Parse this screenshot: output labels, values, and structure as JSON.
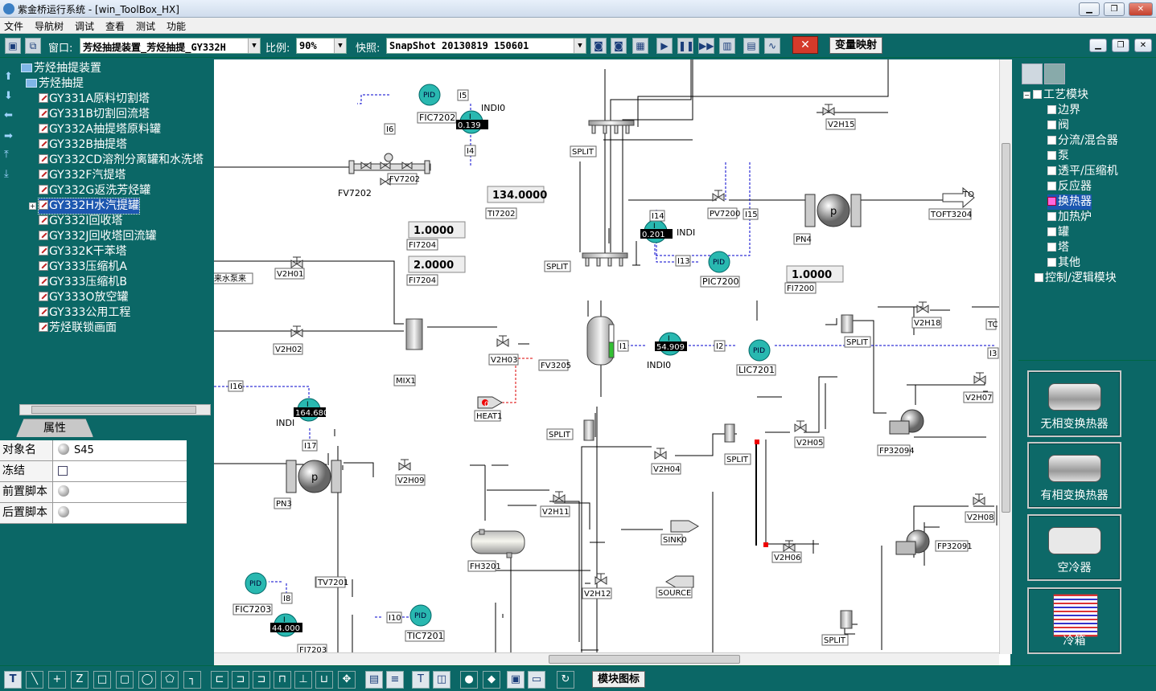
{
  "window": {
    "title": "紫金桥运行系统 - [win_ToolBox_HX]"
  },
  "menu": [
    "文件",
    "导航树",
    "调试",
    "查看",
    "测试",
    "功能"
  ],
  "toolbar": {
    "window_label": "窗口:",
    "window_value": "芳烃抽提装置_芳烃抽提_GY332H",
    "scale_label": "比例:",
    "scale_value": "90%",
    "snapshot_label": "快照:",
    "snapshot_value": "SnapShot 20130819 150601",
    "var_map_label": "变量映射"
  },
  "tree": {
    "root": "芳烃抽提装置",
    "group": "芳烃抽提",
    "items": [
      "GY331A原料切割塔",
      "GY331B切割回流塔",
      "GY332A抽提塔原料罐",
      "GY332B抽提塔",
      "GY332CD溶剂分离罐和水洗塔",
      "GY332F汽提塔",
      "GY332G返洗芳烃罐",
      "GY332H水汽提罐",
      "GY332I回收塔",
      "GY332J回收塔回流罐",
      "GY332K干苯塔",
      "GY333压缩机A",
      "GY333压缩机B",
      "GY333O放空罐",
      "GY333公用工程",
      "芳烃联锁画面"
    ],
    "selected_index": 7
  },
  "properties": {
    "tab": "属性",
    "rows": [
      {
        "key": "对象名",
        "value": "S45",
        "icon": "ball-icon"
      },
      {
        "key": "冻结",
        "value": "",
        "icon": "checkbox-icon"
      },
      {
        "key": "前置脚本",
        "value": "",
        "icon": "ball-icon"
      },
      {
        "key": "后置脚本",
        "value": "",
        "icon": "ball-icon"
      }
    ]
  },
  "canvas": {
    "fic7202": {
      "tag": "FIC7202",
      "pid": "PID",
      "ind_label": "I",
      "ind_value": "0.139",
      "indi": "INDI0"
    },
    "pic7200": {
      "tag": "PIC7200",
      "pid": "PID",
      "ind_value": "0.201",
      "ind_label": "I",
      "indi": "INDI"
    },
    "lic7201": {
      "tag": "LIC7201",
      "pid": "PID",
      "ind_value": "54.909",
      "ind_label": "I",
      "indi": "INDI0"
    },
    "indi_pn3": {
      "ind_value": "164.680",
      "ind_label": "I",
      "indi": "INDI"
    },
    "fic7203": {
      "tag": "FIC7203",
      "pid": "PID",
      "ind_value": "44.000",
      "ind_label": "I"
    },
    "tic7201": {
      "tag": "TIC7201",
      "pid": "PID"
    },
    "displays": [
      {
        "value": "134.0000",
        "tag": "TI7202"
      },
      {
        "value": "1.0000",
        "tag": "FI7204"
      },
      {
        "value": "2.0000",
        "tag": "FI7204"
      },
      {
        "value": "1.0000",
        "tag": "FI7200"
      }
    ],
    "valves": [
      "V2H01",
      "V2H02",
      "V2H03",
      "V2H04",
      "V2H05",
      "V2H06",
      "V2H07",
      "V2H08",
      "V2H09",
      "V2H11",
      "V2H12",
      "V2H15",
      "V2H18",
      "PV7200",
      "FV3205",
      "FV7202",
      "TV7201"
    ],
    "labels": {
      "split": "SPLIT",
      "mix": "MIX1",
      "heat": "HEAT1",
      "fh": "FH3201",
      "sink": "SINK0",
      "source": "SOURCE",
      "pn3": "PN3",
      "pn4": "PN4",
      "pump_letter": "p",
      "fp1": "FP32094",
      "fp2": "FP32091",
      "to": "TO",
      "toft": "TOFT3204",
      "fi7203": "FI7203",
      "water": "来水泵来",
      "tc": "TC",
      "heat_val": "0",
      "i_tags": [
        "I1",
        "I2",
        "I3",
        "I4",
        "I5",
        "I6",
        "I8",
        "I10",
        "I13",
        "I14",
        "I15",
        "I16",
        "I17"
      ]
    }
  },
  "right_tree": {
    "root": "工艺模块",
    "items": [
      "边界",
      "阀",
      "分流/混合器",
      "泵",
      "透平/压缩机",
      "反应器",
      "换热器",
      "加热炉",
      "罐",
      "塔",
      "其他"
    ],
    "selected_index": 6,
    "root2": "控制/逻辑模块"
  },
  "modules": [
    "无相变换热器",
    "有相变换热器",
    "空冷器",
    "冷箱"
  ],
  "bottom": {
    "module_icon_label": "模块图标"
  },
  "colors": {
    "bg_teal": "#0b6766",
    "pid_cyan": "#29b8b0",
    "selection": "#1c57b0"
  }
}
